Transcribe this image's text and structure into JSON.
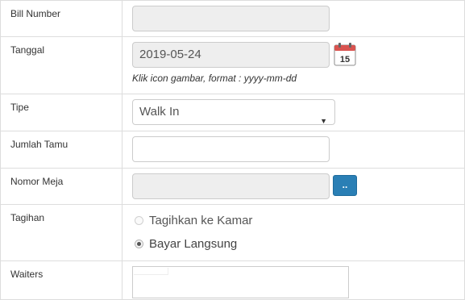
{
  "fields": {
    "bill_number": {
      "label": "Bill Number",
      "value": ""
    },
    "tanggal": {
      "label": "Tanggal",
      "value": "2019-05-24",
      "hint": "Klik icon gambar, format : yyyy-mm-dd",
      "calendar_day": "15"
    },
    "tipe": {
      "label": "Tipe",
      "selected": "Walk In"
    },
    "jumlah_tamu": {
      "label": "Jumlah Tamu",
      "value": ""
    },
    "nomor_meja": {
      "label": "Nomor Meja",
      "value": "",
      "browse_label": ".."
    },
    "tagihan": {
      "label": "Tagihan",
      "options": [
        {
          "label": "Tagihkan ke Kamar",
          "checked": false,
          "disabled": true
        },
        {
          "label": "Bayar Langsung",
          "checked": true,
          "disabled": false
        }
      ]
    },
    "waiters": {
      "label": "Waiters"
    }
  },
  "colors": {
    "border": "#dddddd",
    "disabled_input": "#eeeeee",
    "button": "#2a7fb5",
    "calendar_red": "#d9534f"
  }
}
